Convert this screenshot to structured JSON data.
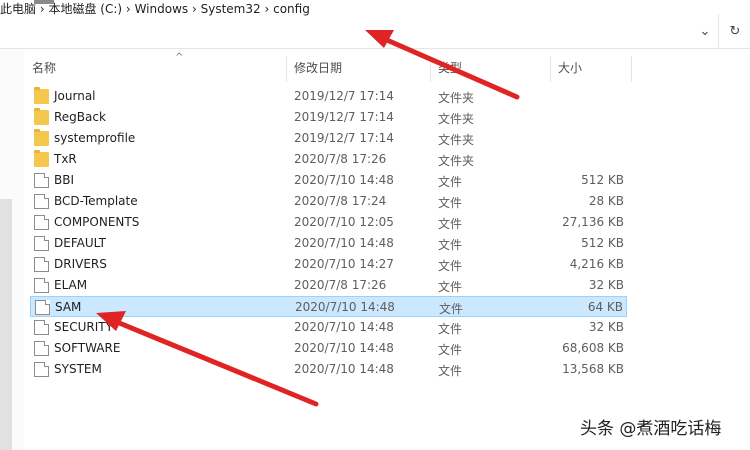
{
  "address_bar": {
    "crumbs": [
      "此电脑",
      "本地磁盘 (C:)",
      "Windows",
      "System32",
      "config"
    ],
    "separator": "›",
    "dropdown_icon": "chevron-down-icon",
    "refresh_icon": "refresh-icon"
  },
  "columns": {
    "name": "名称",
    "modified": "修改日期",
    "type": "类型",
    "size": "大小"
  },
  "files": [
    {
      "name": "Journal",
      "modified": "2019/12/7 17:14",
      "type": "文件夹",
      "size": "",
      "icon": "folder-icon"
    },
    {
      "name": "RegBack",
      "modified": "2019/12/7 17:14",
      "type": "文件夹",
      "size": "",
      "icon": "folder-icon"
    },
    {
      "name": "systemprofile",
      "modified": "2019/12/7 17:14",
      "type": "文件夹",
      "size": "",
      "icon": "folder-icon"
    },
    {
      "name": "TxR",
      "modified": "2020/7/8 17:26",
      "type": "文件夹",
      "size": "",
      "icon": "folder-icon"
    },
    {
      "name": "BBI",
      "modified": "2020/7/10 14:48",
      "type": "文件",
      "size": "512 KB",
      "icon": "file-icon"
    },
    {
      "name": "BCD-Template",
      "modified": "2020/7/8 17:24",
      "type": "文件",
      "size": "28 KB",
      "icon": "file-icon"
    },
    {
      "name": "COMPONENTS",
      "modified": "2020/7/10 12:05",
      "type": "文件",
      "size": "27,136 KB",
      "icon": "file-icon"
    },
    {
      "name": "DEFAULT",
      "modified": "2020/7/10 14:48",
      "type": "文件",
      "size": "512 KB",
      "icon": "file-icon"
    },
    {
      "name": "DRIVERS",
      "modified": "2020/7/10 14:27",
      "type": "文件",
      "size": "4,216 KB",
      "icon": "file-icon"
    },
    {
      "name": "ELAM",
      "modified": "2020/7/8 17:26",
      "type": "文件",
      "size": "32 KB",
      "icon": "file-icon"
    },
    {
      "name": "SAM",
      "modified": "2020/7/10 14:48",
      "type": "文件",
      "size": "64 KB",
      "icon": "file-icon",
      "selected": true
    },
    {
      "name": "SECURITY",
      "modified": "2020/7/10 14:48",
      "type": "文件",
      "size": "32 KB",
      "icon": "file-icon"
    },
    {
      "name": "SOFTWARE",
      "modified": "2020/7/10 14:48",
      "type": "文件",
      "size": "68,608 KB",
      "icon": "file-icon"
    },
    {
      "name": "SYSTEM",
      "modified": "2020/7/10 14:48",
      "type": "文件",
      "size": "13,568 KB",
      "icon": "file-icon"
    }
  ],
  "watermark": "头条 @煮酒吃话梅",
  "colors": {
    "highlight": "#e02424",
    "selection": "#cce8ff",
    "folder": "#f4c84c"
  }
}
